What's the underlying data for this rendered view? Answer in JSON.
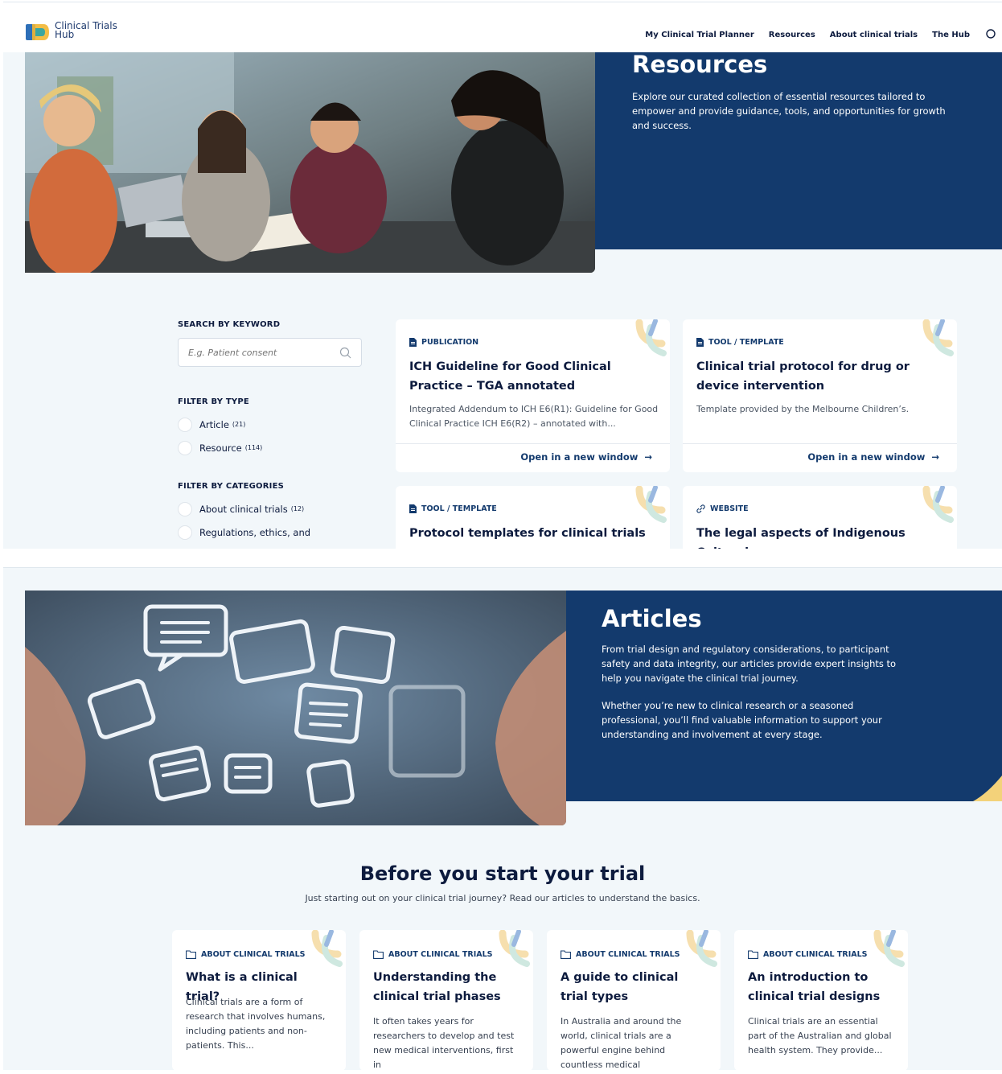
{
  "header": {
    "logo_line1": "Clinical Trials",
    "logo_line2": "Hub",
    "nav": [
      "My Clinical Trial Planner",
      "Resources",
      "About clinical trials",
      "The Hub"
    ]
  },
  "resources_hero": {
    "title": "Resources",
    "text": "Explore our curated collection of essential resources tailored to empower and provide guidance, tools, and opportunities for growth and success."
  },
  "filters": {
    "search_label": "SEARCH BY KEYWORD",
    "search_placeholder": "E.g. Patient consent",
    "type_label": "FILTER BY TYPE",
    "types": [
      {
        "label": "Article",
        "count": "(21)"
      },
      {
        "label": "Resource",
        "count": "(114)"
      }
    ],
    "categories_label": "FILTER BY CATEGORIES",
    "categories": [
      {
        "label": "About clinical trials",
        "count": "(12)"
      },
      {
        "label": "Regulations, ethics, and",
        "count": ""
      }
    ]
  },
  "resource_cards": [
    {
      "tag": "PUBLICATION",
      "title": "ICH Guideline for Good Clinical Practice – TGA annotated",
      "desc": "Integrated Addendum to ICH E6(R1): Guideline for Good Clinical Practice ICH E6(R2) – annotated with...",
      "link": "Open in a new window"
    },
    {
      "tag": "TOOL / TEMPLATE",
      "title": "Clinical trial protocol for drug or device intervention",
      "desc": "Template provided by the Melbourne Children’s.",
      "link": "Open in a new window"
    },
    {
      "tag": "TOOL / TEMPLATE",
      "title": "Protocol templates for clinical trials",
      "desc": "",
      "link": ""
    },
    {
      "tag": "WEBSITE",
      "title": "The legal aspects of Indigenous Cultural",
      "desc": "",
      "link": ""
    }
  ],
  "articles_hero": {
    "title": "Articles",
    "p1": "From trial design and regulatory considerations, to participant safety and data integrity, our articles provide expert insights to help you navigate the clinical trial journey.",
    "p2": "Whether you’re new to clinical research or a seasoned professional, you’ll find valuable information to support your understanding and involvement at every stage."
  },
  "section": {
    "title": "Before you start your trial",
    "subtitle": "Just starting out on your clinical trial journey? Read our articles to understand the basics."
  },
  "article_cards": [
    {
      "tag": "ABOUT CLINICAL TRIALS",
      "title": "What is a clinical trial?",
      "desc": "Clinical trials are a form of research that involves humans, including patients and non-patients. This..."
    },
    {
      "tag": "ABOUT CLINICAL TRIALS",
      "title": "Understanding the clinical trial phases",
      "desc": "It often takes years for researchers to develop and test new medical interventions, first in"
    },
    {
      "tag": "ABOUT CLINICAL TRIALS",
      "title": "A guide to clinical trial types",
      "desc": "In Australia and around the world, clinical trials are a powerful engine behind countless medical"
    },
    {
      "tag": "ABOUT CLINICAL TRIALS",
      "title": "An introduction to clinical trial designs",
      "desc": "Clinical trials are an essential part of the Australian and global health system. They provide..."
    }
  ],
  "colors": {
    "navy": "#133a6d",
    "background": "#f2f7fa",
    "accent_yellow": "#f3d27a",
    "accent_teal": "#cfe8e0"
  }
}
